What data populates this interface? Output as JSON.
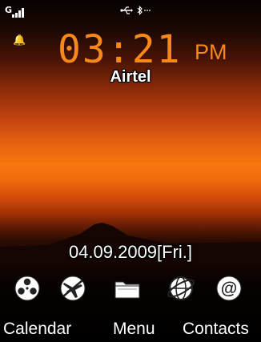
{
  "status_bar": {
    "network_label": "G",
    "icons": [
      "signal-icon",
      "usb-icon",
      "bluetooth-icon"
    ]
  },
  "alarm_icon": "bell-icon",
  "clock": {
    "time": "03:21",
    "period": "PM"
  },
  "operator": "Airtel",
  "date": "04.09.2009[Fri.]",
  "shortcuts": [
    "media-reel-icon",
    "airplane-icon",
    "folder-icon",
    "browser-globe-icon",
    "email-at-icon"
  ],
  "softkeys": {
    "left": "Calendar",
    "center": "Menu",
    "right": "Contacts"
  },
  "colors": {
    "clock": "#f6891a",
    "text": "#ffffff",
    "alarm": "#f7a21a"
  }
}
